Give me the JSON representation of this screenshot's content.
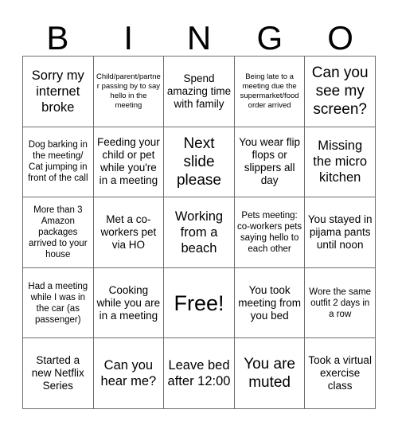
{
  "card": {
    "title_letters": [
      "B",
      "I",
      "N",
      "G",
      "O"
    ],
    "rows": [
      [
        {
          "text": "Sorry my internet broke",
          "size": "lg"
        },
        {
          "text": "Child/parent/partner passing by to say hello in the meeting",
          "size": "xs"
        },
        {
          "text": "Spend amazing time with family",
          "size": "md"
        },
        {
          "text": "Being late to a meeting due the supermarket/food order arrived",
          "size": "xs"
        },
        {
          "text": "Can you see my screen?",
          "size": "xl"
        }
      ],
      [
        {
          "text": "Dog barking in the meeting/ Cat jumping in front of the call",
          "size": "sm"
        },
        {
          "text": "Feeding your child or pet while you're in a meeting",
          "size": "md"
        },
        {
          "text": "Next slide please",
          "size": "xl"
        },
        {
          "text": "You wear flip flops or slippers all day",
          "size": "md"
        },
        {
          "text": "Missing the micro kitchen",
          "size": "lg"
        }
      ],
      [
        {
          "text": "More than 3 Amazon packages arrived to your house",
          "size": "sm"
        },
        {
          "text": "Met a co-workers pet via HO",
          "size": "md"
        },
        {
          "text": "Working from a beach",
          "size": "lg"
        },
        {
          "text": "Pets meeting: co-workers pets saying hello to each other",
          "size": "sm"
        },
        {
          "text": "You stayed in pijama pants until noon",
          "size": "md"
        }
      ],
      [
        {
          "text": "Had a meeting while I was in the car (as passenger)",
          "size": "sm"
        },
        {
          "text": "Cooking while you are in a meeting",
          "size": "md"
        },
        {
          "text": "Free!",
          "size": "xxl"
        },
        {
          "text": "You took meeting from you bed",
          "size": "md"
        },
        {
          "text": "Wore the same outfit 2 days in a row",
          "size": "sm"
        }
      ],
      [
        {
          "text": "Started a new Netflix Series",
          "size": "md"
        },
        {
          "text": "Can you hear me?",
          "size": "lg"
        },
        {
          "text": "Leave bed after 12:00",
          "size": "lg"
        },
        {
          "text": "You are muted",
          "size": "xl"
        },
        {
          "text": "Took a virtual exercise class",
          "size": "md"
        }
      ]
    ]
  },
  "style": {
    "border_color": "#6e6e6e",
    "text_color": "#000000",
    "background": "#ffffff"
  }
}
